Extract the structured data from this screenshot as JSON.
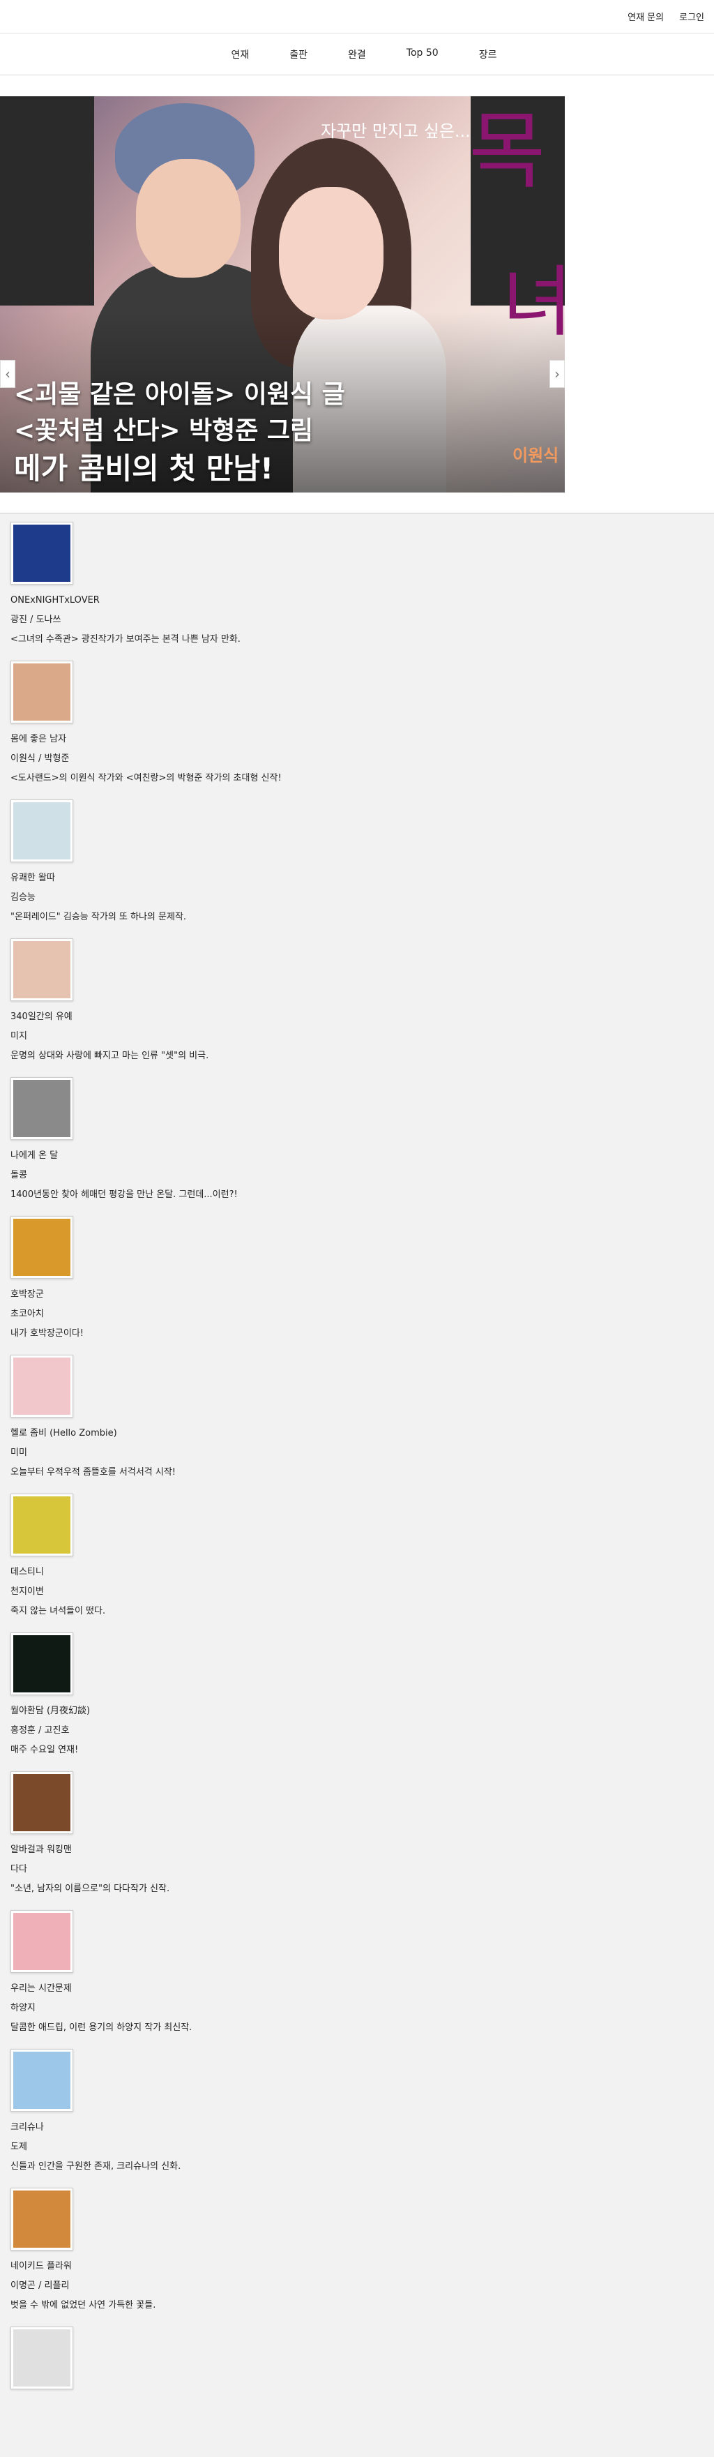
{
  "topbar": {
    "contact": "연재 문의",
    "login": "로그인"
  },
  "nav": {
    "items": [
      "연재",
      "출판",
      "완결",
      "Top 50",
      "장르"
    ]
  },
  "banner": {
    "tagline": "자꾸만 만지고 싶은...",
    "line1": "<괴물 같은 아이돌> 이원식 글",
    "line2": "<꽃처럼 산다> 박형준 그림",
    "line3": "메가 콤비의 첫 만남!",
    "author": "이원식",
    "deco_char": "목",
    "deco_char2": "녀",
    "prev_icon": "‹",
    "next_icon": "›"
  },
  "comics": [
    {
      "title": "ONExNIGHTxLOVER",
      "author": "광진 / 도나쓰",
      "desc": "<그녀의 수족관> 광진작가가 보여주는 본격 나쁜 남자 만화.",
      "color": "#1d3b8a"
    },
    {
      "title": "몸에 좋은 남자",
      "author": "이원식 / 박형준",
      "desc": "<도사랜드>의 이원식 작가와 <여친랑>의 박형준 작가의 초대형 신작!",
      "color": "#d9a98a"
    },
    {
      "title": "유쾌한 왈따",
      "author": "김승능",
      "desc": "\"온퍼레이드\" 김승능 작가의 또 하나의 문제작.",
      "color": "#cfe1e6"
    },
    {
      "title": "340일간의 유예",
      "author": "미지",
      "desc": "운명의 상대와 사랑에 빠지고 마는 인류 \"셋\"의 비극.",
      "color": "#e6c2b0"
    },
    {
      "title": "나에게 온 달",
      "author": "돌콩",
      "desc": "1400년동안 찾아 헤매던 평강을 만난 온달. 그런데...이런?!",
      "color": "#8a8a8a"
    },
    {
      "title": "호박장군",
      "author": "초코아치",
      "desc": "내가 호박장군이다!",
      "color": "#d99a2b"
    },
    {
      "title": "헬로 좀비 (Hello Zombie)",
      "author": "미미",
      "desc": "오늘부터 우적우적 좀뜰호를 서걱서걱 시작!",
      "color": "#f1c7cb"
    },
    {
      "title": "데스티니",
      "author": "천지이변",
      "desc": "죽지 않는 녀석들이 떴다.",
      "color": "#d8c63a"
    },
    {
      "title": "월야환담 (月夜幻談)",
      "author": "홍정훈 / 고진호",
      "desc": "매주 수요일 연재!",
      "color": "#101a14"
    },
    {
      "title": "알바걸과 워킹맨",
      "author": "다다",
      "desc": "\"소년, 남자의 이름으로\"의 다다작가 신작.",
      "color": "#7a4a2a"
    },
    {
      "title": "우리는 시간문제",
      "author": "하양지",
      "desc": "달콤한 애드립, 이런 용기의 하양지 작가 최신작.",
      "color": "#f0b0b8"
    },
    {
      "title": "크리슈나",
      "author": "도제",
      "desc": "신들과 인간을 구원한 존재, 크리슈나의 신화.",
      "color": "#9cc7e8"
    },
    {
      "title": "네이키드 플라워",
      "author": "이명곤 / 리플리",
      "desc": "벗을 수 밖에 없었던 사연 가득한 꽃들.",
      "color": "#d3893b"
    },
    {
      "title": "",
      "author": "",
      "desc": "",
      "color": "#e0e0e0"
    }
  ]
}
